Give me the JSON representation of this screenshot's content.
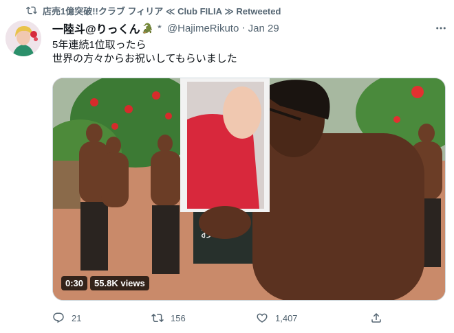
{
  "retweet": {
    "text": "店売1億突破!!クラブ フィリア ≪ Club FILIA ≫ Retweeted"
  },
  "tweet": {
    "display_name": "一陸斗@りっくん",
    "name_emoji": "🐊",
    "verified_mark": "*",
    "handle": "@HajimeRikuto",
    "date": "Jan 29",
    "text_line1": "5年連続1位取ったら",
    "text_line2": "世界の方々からお祝いしてもらいました"
  },
  "video": {
    "duration": "0:30",
    "views": "55.8K views",
    "sign_text": "お",
    "sign_text2": "他"
  },
  "actions": {
    "reply_count": "21",
    "retweet_count": "156",
    "like_count": "1,407"
  },
  "icons": [
    "retweet-icon",
    "more-icon",
    "reply-icon",
    "like-icon",
    "share-icon"
  ],
  "colors": {
    "text_primary": "#0f1419",
    "text_secondary": "#536471",
    "border": "#cfd9de"
  }
}
